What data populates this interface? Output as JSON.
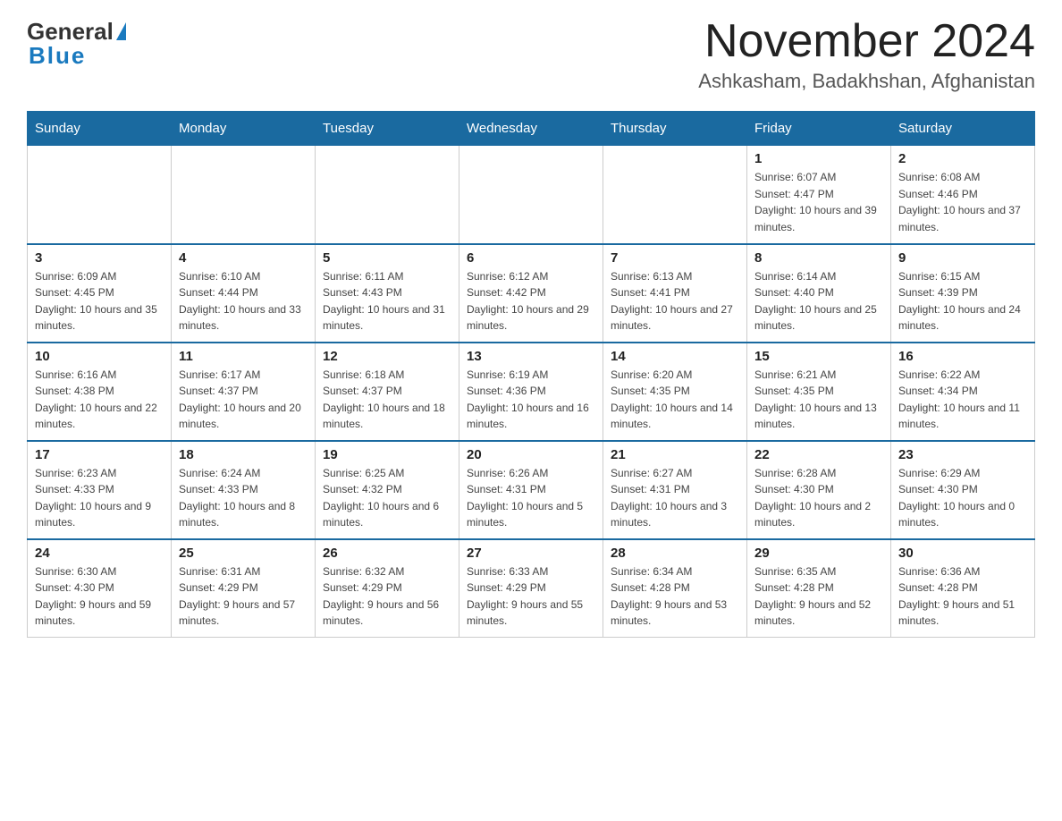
{
  "header": {
    "logo_general": "General",
    "logo_blue": "Blue",
    "month_title": "November 2024",
    "location": "Ashkasham, Badakhshan, Afghanistan"
  },
  "days_of_week": [
    "Sunday",
    "Monday",
    "Tuesday",
    "Wednesday",
    "Thursday",
    "Friday",
    "Saturday"
  ],
  "weeks": [
    [
      {
        "day": "",
        "info": ""
      },
      {
        "day": "",
        "info": ""
      },
      {
        "day": "",
        "info": ""
      },
      {
        "day": "",
        "info": ""
      },
      {
        "day": "",
        "info": ""
      },
      {
        "day": "1",
        "info": "Sunrise: 6:07 AM\nSunset: 4:47 PM\nDaylight: 10 hours and 39 minutes."
      },
      {
        "day": "2",
        "info": "Sunrise: 6:08 AM\nSunset: 4:46 PM\nDaylight: 10 hours and 37 minutes."
      }
    ],
    [
      {
        "day": "3",
        "info": "Sunrise: 6:09 AM\nSunset: 4:45 PM\nDaylight: 10 hours and 35 minutes."
      },
      {
        "day": "4",
        "info": "Sunrise: 6:10 AM\nSunset: 4:44 PM\nDaylight: 10 hours and 33 minutes."
      },
      {
        "day": "5",
        "info": "Sunrise: 6:11 AM\nSunset: 4:43 PM\nDaylight: 10 hours and 31 minutes."
      },
      {
        "day": "6",
        "info": "Sunrise: 6:12 AM\nSunset: 4:42 PM\nDaylight: 10 hours and 29 minutes."
      },
      {
        "day": "7",
        "info": "Sunrise: 6:13 AM\nSunset: 4:41 PM\nDaylight: 10 hours and 27 minutes."
      },
      {
        "day": "8",
        "info": "Sunrise: 6:14 AM\nSunset: 4:40 PM\nDaylight: 10 hours and 25 minutes."
      },
      {
        "day": "9",
        "info": "Sunrise: 6:15 AM\nSunset: 4:39 PM\nDaylight: 10 hours and 24 minutes."
      }
    ],
    [
      {
        "day": "10",
        "info": "Sunrise: 6:16 AM\nSunset: 4:38 PM\nDaylight: 10 hours and 22 minutes."
      },
      {
        "day": "11",
        "info": "Sunrise: 6:17 AM\nSunset: 4:37 PM\nDaylight: 10 hours and 20 minutes."
      },
      {
        "day": "12",
        "info": "Sunrise: 6:18 AM\nSunset: 4:37 PM\nDaylight: 10 hours and 18 minutes."
      },
      {
        "day": "13",
        "info": "Sunrise: 6:19 AM\nSunset: 4:36 PM\nDaylight: 10 hours and 16 minutes."
      },
      {
        "day": "14",
        "info": "Sunrise: 6:20 AM\nSunset: 4:35 PM\nDaylight: 10 hours and 14 minutes."
      },
      {
        "day": "15",
        "info": "Sunrise: 6:21 AM\nSunset: 4:35 PM\nDaylight: 10 hours and 13 minutes."
      },
      {
        "day": "16",
        "info": "Sunrise: 6:22 AM\nSunset: 4:34 PM\nDaylight: 10 hours and 11 minutes."
      }
    ],
    [
      {
        "day": "17",
        "info": "Sunrise: 6:23 AM\nSunset: 4:33 PM\nDaylight: 10 hours and 9 minutes."
      },
      {
        "day": "18",
        "info": "Sunrise: 6:24 AM\nSunset: 4:33 PM\nDaylight: 10 hours and 8 minutes."
      },
      {
        "day": "19",
        "info": "Sunrise: 6:25 AM\nSunset: 4:32 PM\nDaylight: 10 hours and 6 minutes."
      },
      {
        "day": "20",
        "info": "Sunrise: 6:26 AM\nSunset: 4:31 PM\nDaylight: 10 hours and 5 minutes."
      },
      {
        "day": "21",
        "info": "Sunrise: 6:27 AM\nSunset: 4:31 PM\nDaylight: 10 hours and 3 minutes."
      },
      {
        "day": "22",
        "info": "Sunrise: 6:28 AM\nSunset: 4:30 PM\nDaylight: 10 hours and 2 minutes."
      },
      {
        "day": "23",
        "info": "Sunrise: 6:29 AM\nSunset: 4:30 PM\nDaylight: 10 hours and 0 minutes."
      }
    ],
    [
      {
        "day": "24",
        "info": "Sunrise: 6:30 AM\nSunset: 4:30 PM\nDaylight: 9 hours and 59 minutes."
      },
      {
        "day": "25",
        "info": "Sunrise: 6:31 AM\nSunset: 4:29 PM\nDaylight: 9 hours and 57 minutes."
      },
      {
        "day": "26",
        "info": "Sunrise: 6:32 AM\nSunset: 4:29 PM\nDaylight: 9 hours and 56 minutes."
      },
      {
        "day": "27",
        "info": "Sunrise: 6:33 AM\nSunset: 4:29 PM\nDaylight: 9 hours and 55 minutes."
      },
      {
        "day": "28",
        "info": "Sunrise: 6:34 AM\nSunset: 4:28 PM\nDaylight: 9 hours and 53 minutes."
      },
      {
        "day": "29",
        "info": "Sunrise: 6:35 AM\nSunset: 4:28 PM\nDaylight: 9 hours and 52 minutes."
      },
      {
        "day": "30",
        "info": "Sunrise: 6:36 AM\nSunset: 4:28 PM\nDaylight: 9 hours and 51 minutes."
      }
    ]
  ]
}
